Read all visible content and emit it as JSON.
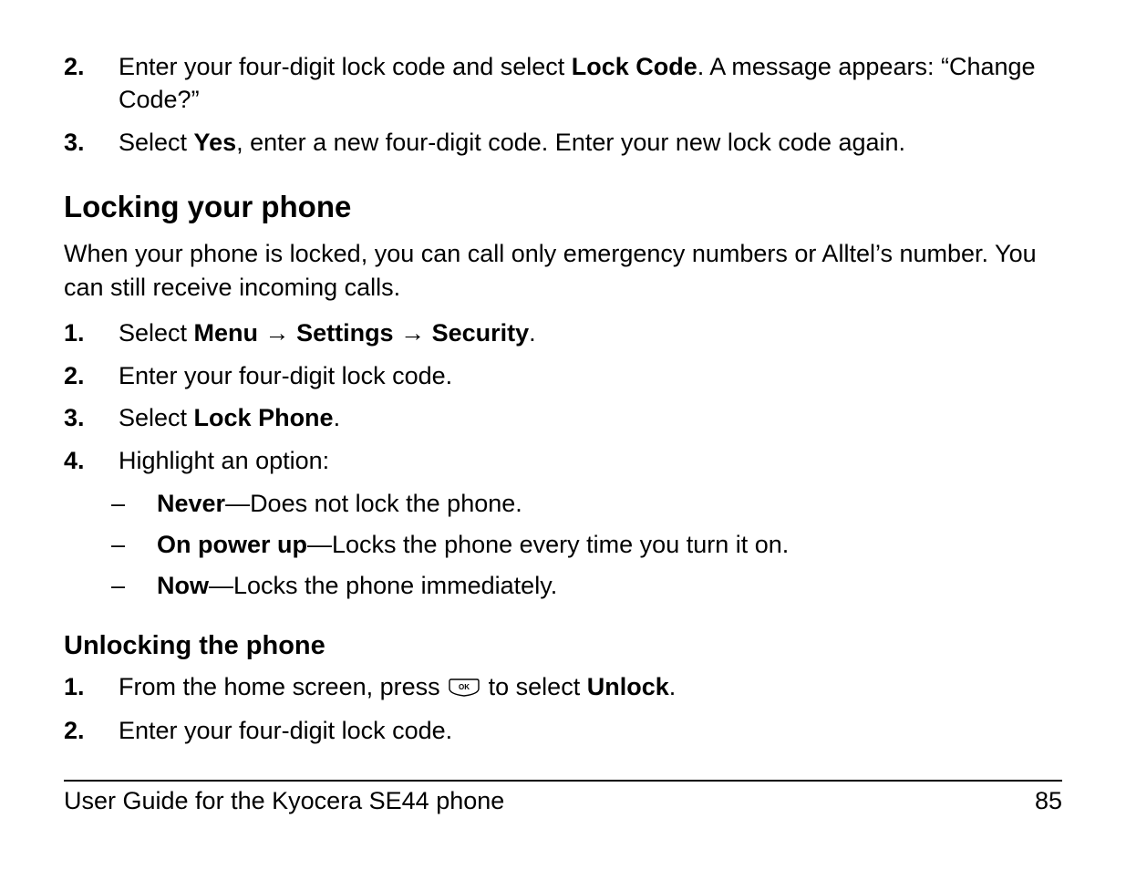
{
  "top_steps": [
    {
      "num": "2.",
      "pre": "Enter your four-digit lock code and select ",
      "bold1": "Lock Code",
      "post": ". A message appears: “Change Code?”"
    },
    {
      "num": "3.",
      "pre": "Select ",
      "bold1": "Yes",
      "post": ", enter a new four-digit code. Enter your new lock code again."
    }
  ],
  "section1": {
    "heading": "Locking your phone",
    "para": "When your phone is locked, you can call only emergency numbers or Alltel’s number. You can still receive incoming calls.",
    "steps": [
      {
        "num": "1.",
        "pre": "Select ",
        "nav": [
          "Menu",
          "Settings",
          "Security"
        ],
        "post": "."
      },
      {
        "num": "2.",
        "plain": "Enter your four-digit lock code."
      },
      {
        "num": "3.",
        "pre": "Select ",
        "bold1": "Lock Phone",
        "post": "."
      },
      {
        "num": "4.",
        "plain": "Highlight an option:",
        "subs": [
          {
            "bold": "Never",
            "rest": "—Does not lock the phone."
          },
          {
            "bold": "On power up",
            "rest": "—Locks the phone every time you turn it on."
          },
          {
            "bold": "Now",
            "rest": "—Locks the phone immediately."
          }
        ]
      }
    ]
  },
  "section2": {
    "heading": "Unlocking the phone",
    "steps": [
      {
        "num": "1.",
        "pre": "From the home screen, press ",
        "icon": "ok",
        "mid": " to select ",
        "bold1": "Unlock",
        "post": "."
      },
      {
        "num": "2.",
        "plain": "Enter your four-digit lock code."
      }
    ]
  },
  "footer": {
    "title": "User Guide for the Kyocera SE44 phone",
    "page": "85"
  },
  "arrow_glyph": "→"
}
